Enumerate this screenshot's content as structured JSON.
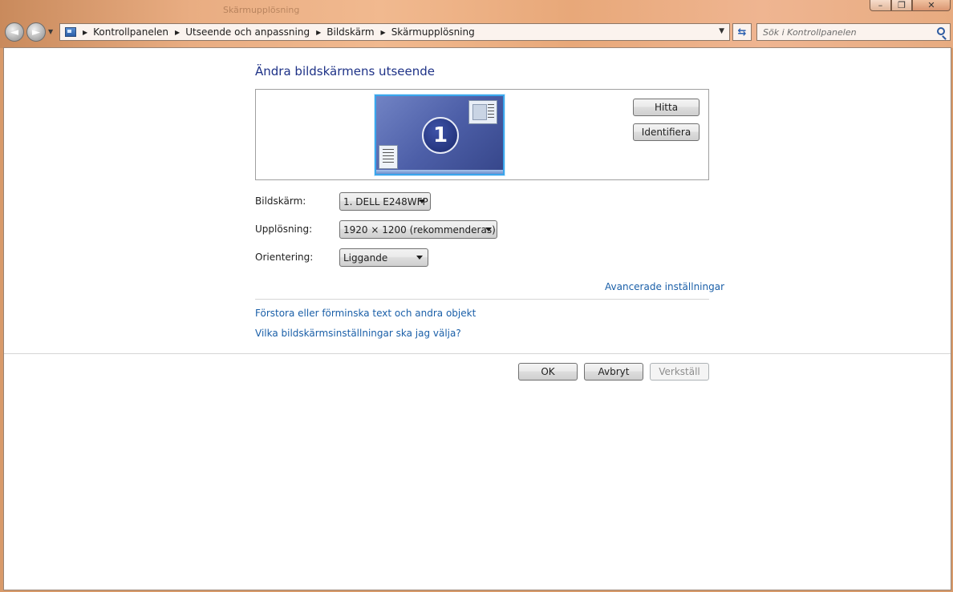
{
  "window": {
    "ghost_title": "Skärmupplösning"
  },
  "nav": {
    "back_glyph": "◄",
    "forward_glyph": "►"
  },
  "breadcrumbs": [
    "Kontrollpanelen",
    "Utseende och anpassning",
    "Bildskärm",
    "Skärmupplösning"
  ],
  "search": {
    "placeholder": "Sök i Kontrollpanelen"
  },
  "main": {
    "title": "Ändra bildskärmens utseende",
    "monitor_number": "1",
    "detect_label": "Hitta",
    "identify_label": "Identifiera",
    "display_label": "Bildskärm:",
    "display_value": "1. DELL E248WFP",
    "resolution_label": "Upplösning:",
    "resolution_value": "1920 × 1200 (rekommenderas)",
    "orientation_label": "Orientering:",
    "orientation_value": "Liggande",
    "advanced_link": "Avancerade inställningar",
    "link_text_size": "Förstora eller förminska text och andra objekt",
    "link_help": "Vilka bildskärmsinställningar ska jag välja?"
  },
  "footer": {
    "ok_label": "OK",
    "cancel_label": "Avbryt",
    "apply_label": "Verkställ"
  },
  "colors": {
    "frame_accent": "#e9ad82",
    "title_blue": "#1e3287",
    "link_blue": "#1a5fa8",
    "monitor_highlight": "#3aa6ec"
  }
}
